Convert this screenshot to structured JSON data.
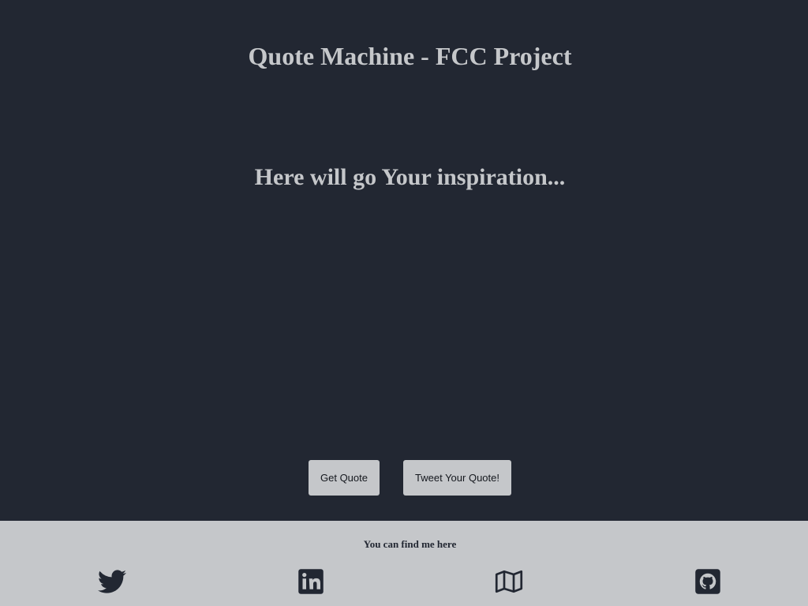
{
  "app": {
    "title": "Quote Machine - FCC Project"
  },
  "quote": {
    "text": "Here will go Your inspiration..."
  },
  "actions": {
    "get_quote_label": "Get Quote",
    "tweet_label": "Tweet Your Quote!"
  },
  "footer": {
    "heading": "You can find me here",
    "links": [
      {
        "icon": "twitter-icon"
      },
      {
        "icon": "linkedin-icon"
      },
      {
        "icon": "map-icon"
      },
      {
        "icon": "github-icon"
      }
    ]
  },
  "colors": {
    "background": "#222732",
    "text": "#c5c7ca",
    "footer_background": "#c5c7ca",
    "button_background": "#c5c7ca"
  }
}
